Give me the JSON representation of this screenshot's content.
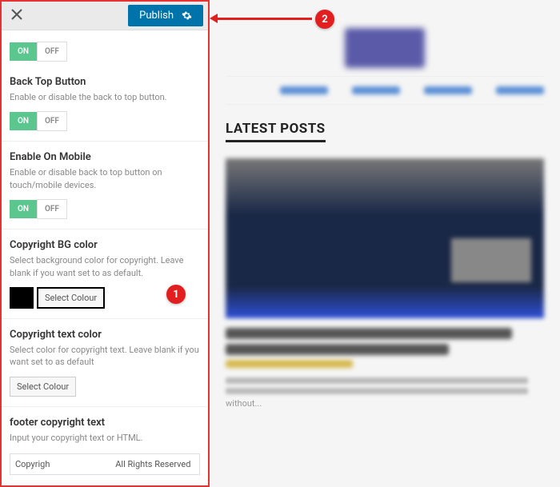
{
  "header": {
    "publish_label": "Publish"
  },
  "toggles": {
    "on_label": "ON",
    "off_label": "OFF"
  },
  "sections": {
    "back_top": {
      "title": "Back Top Button",
      "desc": "Enable or disable the back to top button."
    },
    "mobile": {
      "title": "Enable On Mobile",
      "desc": "Enable or disable back to top button on touch/mobile devices."
    },
    "bg_color": {
      "title": "Copyright BG color",
      "desc": "Select background color for copyright. Leave blank if you want set to as default.",
      "button": "Select Colour"
    },
    "text_color": {
      "title": "Copyright text color",
      "desc": "Select color for copyright text. Leave blank if you want set to as default",
      "button": "Select Colour"
    },
    "footer_text": {
      "title": "footer copyright text",
      "desc": "Input your copyright text or HTML.",
      "value": "Copyrigh                              All Rights Reserved"
    }
  },
  "preview": {
    "latest_posts": "LATEST POSTS",
    "without": "without..."
  },
  "callouts": {
    "one": "1",
    "two": "2"
  }
}
